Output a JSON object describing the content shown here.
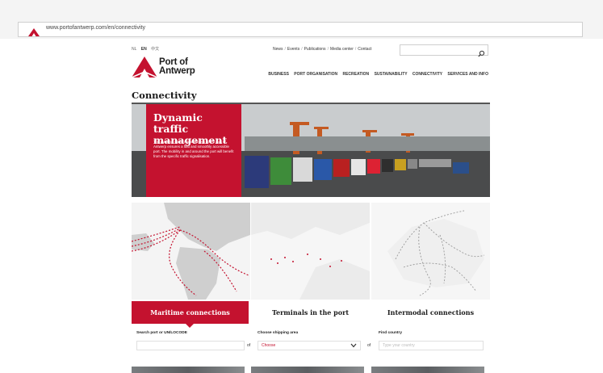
{
  "browser": {
    "url": "www.portofantwerp.com/en/connectivity"
  },
  "header": {
    "languages": [
      "NL",
      "EN",
      "中文"
    ],
    "top_links": [
      "News",
      "Events",
      "Publications",
      "Media center",
      "Contact"
    ],
    "separator": "/",
    "logo_line1": "Port of",
    "logo_line2": "Antwerp",
    "main_nav": [
      "BUSINESS",
      "PORT ORGANISATION",
      "RECREATION",
      "SUSTAINABILITY",
      "CONNECTIVITY",
      "SERVICES AND INFO"
    ]
  },
  "page": {
    "title": "Connectivity"
  },
  "hero": {
    "title": "Dynamic traffic management",
    "description": "The dynamic traffic management at the port of Antwerp ensures a fast and smoothly accessible port. The mobility in and around the port will benefit from the specific traffic signalisation.",
    "slides_total": 5,
    "active_slide": 4
  },
  "connections": {
    "tabs": [
      "Maritime connections",
      "Terminals in the port",
      "Intermodal connections"
    ],
    "active_tab": 0
  },
  "search": {
    "port_label": "Search port or UN/LOCODE",
    "or_text": "of",
    "area_label": "Choose shipping area",
    "area_value": "Choose",
    "country_label": "Find country",
    "country_placeholder": "Type your country"
  },
  "colors": {
    "brand_red": "#c4122f"
  }
}
